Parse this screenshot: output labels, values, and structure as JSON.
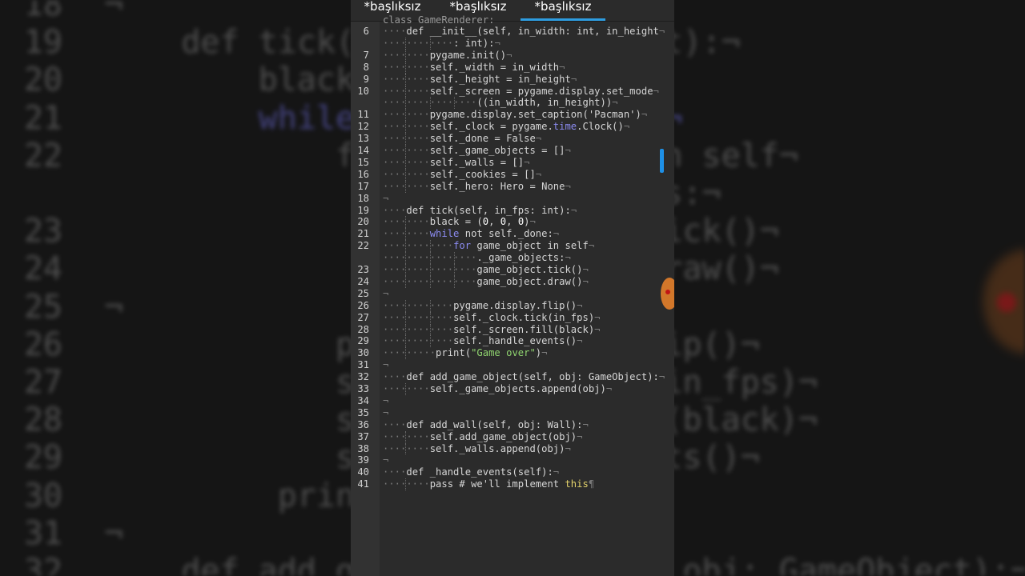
{
  "window": {
    "tabs": [
      {
        "label": "*başlıksız",
        "active": false
      },
      {
        "label": "*başlıksız",
        "active": false
      },
      {
        "label": "*başlıksız",
        "active": true
      }
    ]
  },
  "editor": {
    "partial_top_line": "class GameRenderer:",
    "lines": [
      {
        "n": "6",
        "indent": 1,
        "parts": [
          {
            "t": "def __init__(self, in_width: int, in_height"
          }
        ]
      },
      {
        "n": "",
        "indent": 3,
        "parts": [
          {
            "t": ": int):"
          }
        ]
      },
      {
        "n": "7",
        "indent": 2,
        "parts": [
          {
            "t": "pygame.init()"
          }
        ]
      },
      {
        "n": "8",
        "indent": 2,
        "parts": [
          {
            "t": "self._width = in_width"
          }
        ]
      },
      {
        "n": "9",
        "indent": 2,
        "parts": [
          {
            "t": "self._height = in_height"
          }
        ]
      },
      {
        "n": "10",
        "indent": 2,
        "parts": [
          {
            "t": "self._screen = pygame.display.set_mode"
          }
        ]
      },
      {
        "n": "",
        "indent": 4,
        "parts": [
          {
            "t": "((in_width, in_height))"
          }
        ]
      },
      {
        "n": "11",
        "indent": 2,
        "parts": [
          {
            "t": "pygame.display.set_caption('Pacman')"
          }
        ]
      },
      {
        "n": "12",
        "indent": 2,
        "parts": [
          {
            "t": "self._clock = pygame."
          },
          {
            "t": "time",
            "c": "kw"
          },
          {
            "t": ".Clock()"
          }
        ]
      },
      {
        "n": "13",
        "indent": 2,
        "parts": [
          {
            "t": "self._done = False"
          }
        ]
      },
      {
        "n": "14",
        "indent": 2,
        "parts": [
          {
            "t": "self._game_objects = []"
          }
        ]
      },
      {
        "n": "15",
        "indent": 2,
        "parts": [
          {
            "t": "self._walls = []"
          }
        ]
      },
      {
        "n": "16",
        "indent": 2,
        "parts": [
          {
            "t": "self._cookies = []"
          }
        ]
      },
      {
        "n": "17",
        "indent": 2,
        "parts": [
          {
            "t": "self._hero: Hero = None"
          }
        ]
      },
      {
        "n": "18",
        "indent": 0,
        "parts": [
          {
            "t": ""
          }
        ]
      },
      {
        "n": "19",
        "indent": 1,
        "parts": [
          {
            "t": "def tick(self, in_fps: int):"
          }
        ]
      },
      {
        "n": "20",
        "indent": 2,
        "parts": [
          {
            "t": "black = ("
          },
          {
            "t": "0",
            "c": "num"
          },
          {
            "t": ", "
          },
          {
            "t": "0",
            "c": "num"
          },
          {
            "t": ", "
          },
          {
            "t": "0",
            "c": "num"
          },
          {
            "t": ")"
          }
        ]
      },
      {
        "n": "21",
        "indent": 2,
        "parts": [
          {
            "t": "while",
            "c": "kw"
          },
          {
            "t": " not self._done:"
          }
        ]
      },
      {
        "n": "22",
        "indent": 3,
        "parts": [
          {
            "t": "for",
            "c": "kw"
          },
          {
            "t": " game_object in self"
          }
        ]
      },
      {
        "n": "",
        "indent": 4,
        "parts": [
          {
            "t": "._game_objects:"
          }
        ]
      },
      {
        "n": "23",
        "indent": 4,
        "parts": [
          {
            "t": "game_object.tick()"
          }
        ]
      },
      {
        "n": "24",
        "indent": 4,
        "parts": [
          {
            "t": "game_object.draw()"
          }
        ]
      },
      {
        "n": "25",
        "indent": 0,
        "parts": [
          {
            "t": ""
          }
        ]
      },
      {
        "n": "26",
        "indent": 3,
        "parts": [
          {
            "t": "pygame.display.flip()"
          }
        ]
      },
      {
        "n": "27",
        "indent": 3,
        "parts": [
          {
            "t": "self._clock.tick(in_fps)"
          }
        ]
      },
      {
        "n": "28",
        "indent": 3,
        "parts": [
          {
            "t": "self._screen.fill(black)"
          }
        ]
      },
      {
        "n": "29",
        "indent": 3,
        "parts": [
          {
            "t": "self._handle_events()"
          }
        ]
      },
      {
        "n": "30",
        "indent": 2.3,
        "parts": [
          {
            "t": "print("
          },
          {
            "t": "\"Game over\"",
            "c": "str"
          },
          {
            "t": ")"
          }
        ]
      },
      {
        "n": "31",
        "indent": 0,
        "parts": [
          {
            "t": ""
          }
        ]
      },
      {
        "n": "32",
        "indent": 1,
        "parts": [
          {
            "t": "def add_game_object(self, obj: GameObject):"
          }
        ]
      },
      {
        "n": "33",
        "indent": 2,
        "parts": [
          {
            "t": "self._game_objects.append(obj)"
          }
        ]
      },
      {
        "n": "34",
        "indent": 0,
        "parts": [
          {
            "t": ""
          }
        ]
      },
      {
        "n": "35",
        "indent": 0,
        "parts": [
          {
            "t": ""
          }
        ]
      },
      {
        "n": "36",
        "indent": 1,
        "parts": [
          {
            "t": "def add_wall(self, obj: Wall):"
          }
        ]
      },
      {
        "n": "37",
        "indent": 2,
        "parts": [
          {
            "t": "self.add_game_object(obj)"
          }
        ]
      },
      {
        "n": "38",
        "indent": 2,
        "parts": [
          {
            "t": "self._walls.append(obj)"
          }
        ]
      },
      {
        "n": "39",
        "indent": 0,
        "parts": [
          {
            "t": ""
          }
        ]
      },
      {
        "n": "40",
        "indent": 1,
        "parts": [
          {
            "t": "def _handle_events(self):"
          }
        ]
      },
      {
        "n": "41",
        "indent": 2,
        "parts": [
          {
            "t": "pass # we'll implement "
          },
          {
            "t": "this",
            "c": "spec"
          }
        ],
        "end": "¶"
      }
    ]
  },
  "background": {
    "lines": [
      {
        "n": "18",
        "code": ""
      },
      {
        "n": "19",
        "code": "    def tick(self, in_fps: int):"
      },
      {
        "n": "20",
        "code": "        black = (0, 0, 0)"
      },
      {
        "n": "21",
        "code": "        while not self._done:",
        "kw": "while"
      },
      {
        "n": "22",
        "code": "            for game_object in self"
      },
      {
        "n": "",
        "code": "                ._game_objects:"
      },
      {
        "n": "23",
        "code": "                game_object.tick()"
      },
      {
        "n": "24",
        "code": "                game_object.draw()"
      },
      {
        "n": "25",
        "code": ""
      },
      {
        "n": "26",
        "code": "            pygame.display.flip()"
      },
      {
        "n": "27",
        "code": "            self._clock.tick(in_fps)"
      },
      {
        "n": "28",
        "code": "            self._screen.fill(black)"
      },
      {
        "n": "29",
        "code": "            self._handle_events()"
      },
      {
        "n": "30",
        "code": "         print(\"Game over\")"
      },
      {
        "n": "31",
        "code": ""
      },
      {
        "n": "32",
        "code": "    def add_game_object(self, obj: GameObject):"
      }
    ]
  }
}
